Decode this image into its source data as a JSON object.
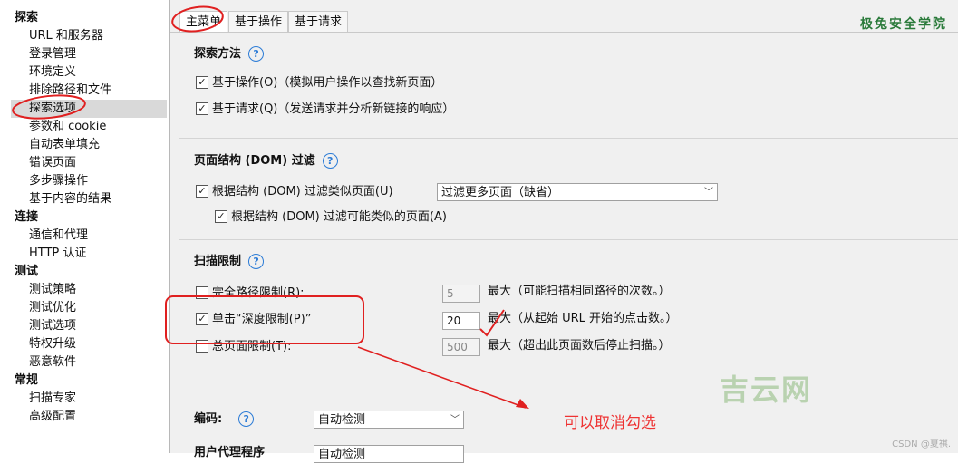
{
  "tree": {
    "categories": [
      {
        "label": "探索",
        "items": [
          "URL 和服务器",
          "登录管理",
          "环境定义",
          "排除路径和文件",
          "探索选项",
          "参数和 cookie",
          "自动表单填充",
          "错误页面",
          "多步骤操作",
          "基于内容的结果"
        ]
      },
      {
        "label": "连接",
        "items": [
          "通信和代理",
          "HTTP 认证"
        ]
      },
      {
        "label": "测试",
        "items": [
          "测试策略",
          "测试优化",
          "测试选项",
          "特权升级",
          "恶意软件"
        ]
      },
      {
        "label": "常规",
        "items": [
          "扫描专家",
          "高级配置"
        ]
      }
    ],
    "selected": "探索选项"
  },
  "tabs": [
    "主菜单",
    "基于操作",
    "基于请求"
  ],
  "brand": "极兔安全学院",
  "explore_method": {
    "title": "探索方法",
    "options": [
      "基于操作(O)（模拟用户操作以查找新页面）",
      "基于请求(Q)（发送请求并分析新链接的响应）"
    ]
  },
  "dom_filter": {
    "title": "页面结构 (DOM) 过滤",
    "opt1": "根据结构 (DOM) 过滤类似页面(U)",
    "select_value": "过滤更多页面（缺省）",
    "opt2": "根据结构 (DOM) 过滤可能类似的页面(A)"
  },
  "scan_limit": {
    "title": "扫描限制",
    "rows": [
      {
        "label": "完全路径限制(R):",
        "checked": false,
        "value": "5",
        "desc": "最大（可能扫描相同路径的次数。）"
      },
      {
        "label": "单击“深度限制(P)”",
        "checked": true,
        "value": "20",
        "desc": "最大（从起始 URL 开始的点击数。）"
      },
      {
        "label": "总页面限制(T):",
        "checked": false,
        "value": "500",
        "desc": "最大（超出此页面数后停止扫描。）"
      }
    ]
  },
  "encoding": {
    "label": "编码:",
    "value": "自动检测"
  },
  "partial_label": "用户代理程序",
  "partial_value": "自动检测",
  "annotation": "可以取消勾选",
  "watermark": "吉云网",
  "csdn": "CSDN @夏祺."
}
